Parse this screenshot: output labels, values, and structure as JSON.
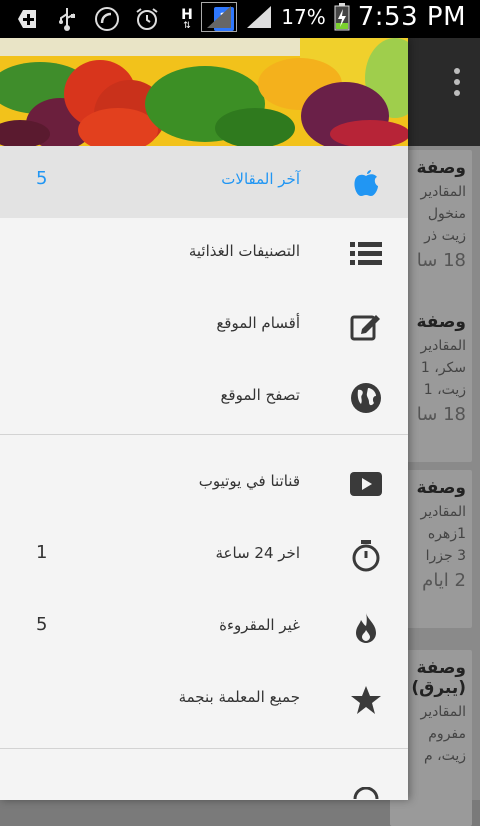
{
  "status_bar": {
    "icons": [
      "add-icon",
      "usb-icon",
      "call-forward-icon",
      "alarm-icon",
      "h-data-icon",
      "sim-1-icon",
      "signal-empty-icon",
      "signal-icon",
      "battery-charging-icon"
    ],
    "h_label": "H",
    "sim_badge": "1",
    "battery_percent": "17%",
    "time": "7:53 PM"
  },
  "drawer": {
    "header_image": "vegetables-banner",
    "items": [
      {
        "label": "آخر المقالات",
        "count": "5",
        "icon": "apple-icon",
        "active": true
      },
      {
        "label": "التصنيفات الغذائية",
        "count": "",
        "icon": "list-icon",
        "active": false
      },
      {
        "label": "أقسام الموقع",
        "count": "",
        "icon": "edit-icon",
        "active": false
      },
      {
        "label": "تصفح الموقع",
        "count": "",
        "icon": "globe-icon",
        "active": false
      },
      {
        "label": "قناتنا في يوتيوب",
        "count": "",
        "icon": "youtube-icon",
        "active": false
      },
      {
        "label": "اخر 24 ساعة",
        "count": "1",
        "icon": "stopwatch-icon",
        "active": false
      },
      {
        "label": "غير المقروءة",
        "count": "5",
        "icon": "fire-icon",
        "active": false
      },
      {
        "label": "جميع المعلمة بنجمة",
        "count": "",
        "icon": "star-icon",
        "active": false
      }
    ]
  },
  "background_cards": [
    {
      "title": "وصفة",
      "line1": "المقادير",
      "line2": "منخول",
      "line3": "زيت ذر",
      "counter": "18 سا"
    },
    {
      "title": "وصفة",
      "line1": "المقادير",
      "line2": "سكر، 1",
      "line3": "زيت، 1",
      "counter": "18 سا"
    },
    {
      "title": "وصفة",
      "line1": "المقادير",
      "line2": "1زهره",
      "line3": "3 جزرا",
      "counter": "2 ايام"
    },
    {
      "title": "وصفة",
      "line1": "(يبرق)",
      "line2": "المقادير",
      "line3": "مفروم",
      "counter": "زيت، م"
    }
  ],
  "colors": {
    "accent": "#2196f3",
    "drawer_bg": "#f4f4f4",
    "active_row_bg": "#e3e3e3",
    "icon": "#3a3a3a"
  }
}
